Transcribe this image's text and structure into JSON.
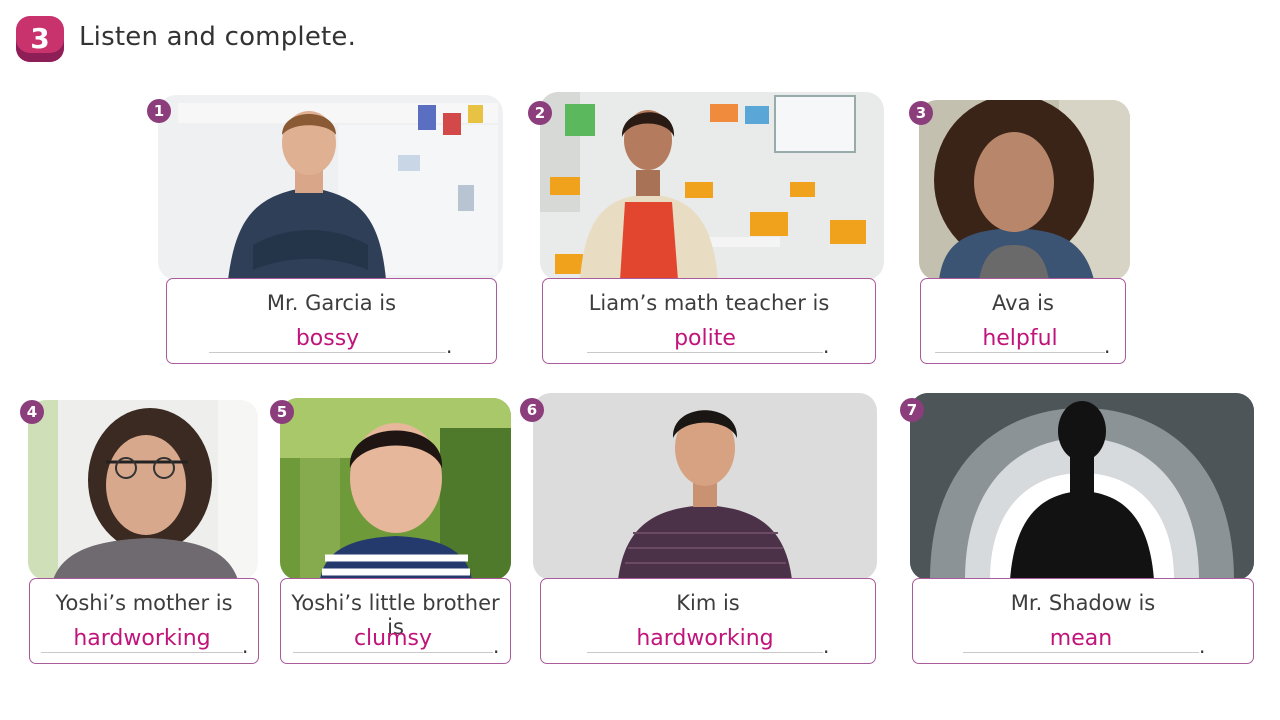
{
  "header": {
    "exercise_number": "3",
    "instruction": "Listen and complete."
  },
  "items": [
    {
      "number": "1",
      "prompt": "Mr. Garcia is",
      "answer": "bossy",
      "end": "."
    },
    {
      "number": "2",
      "prompt": "Liam’s math teacher is",
      "answer": "polite",
      "end": "."
    },
    {
      "number": "3",
      "prompt": "Ava is",
      "answer": "helpful",
      "end": "."
    },
    {
      "number": "4",
      "prompt": "Yoshi’s mother is",
      "answer": "hardworking",
      "end": "."
    },
    {
      "number": "5",
      "prompt": "Yoshi’s little brother is",
      "answer": "clumsy",
      "end": "."
    },
    {
      "number": "6",
      "prompt": "Kim is",
      "answer": "hardworking",
      "end": "."
    },
    {
      "number": "7",
      "prompt": "Mr. Shadow is",
      "answer": "mean",
      "end": "."
    }
  ],
  "colors": {
    "badge": "#c8336e",
    "number_circle": "#8b3d7c",
    "border": "#a95b9c",
    "answer": "#c0147a"
  }
}
